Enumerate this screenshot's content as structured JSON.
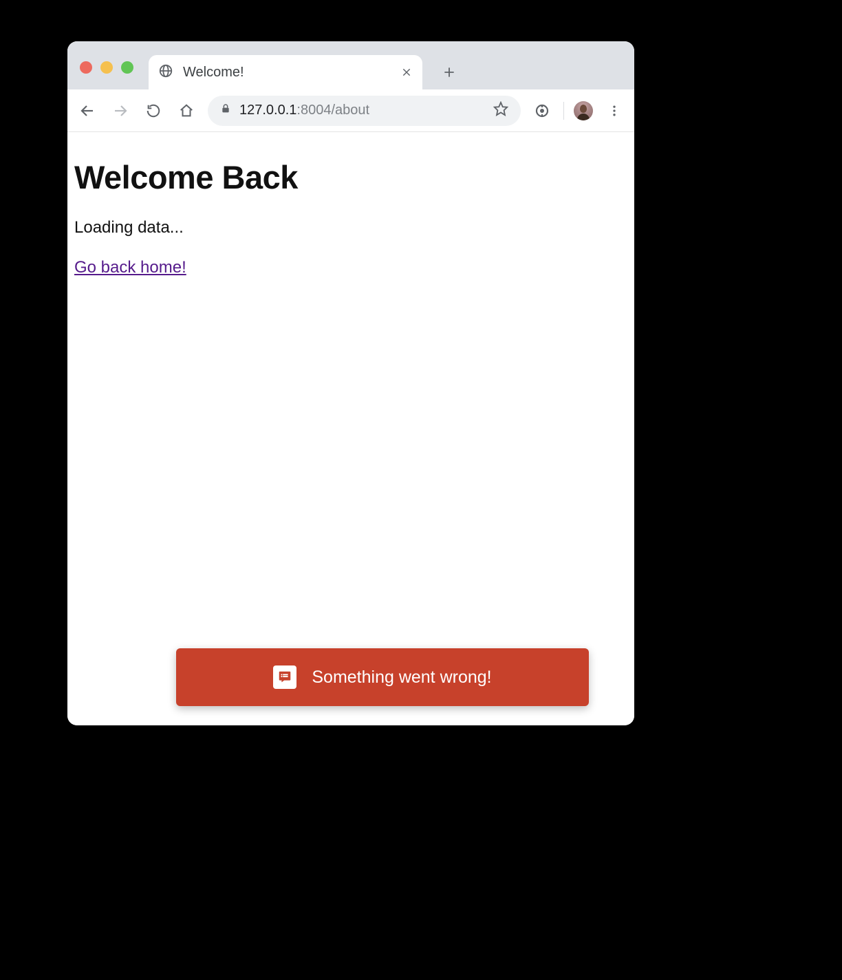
{
  "browser": {
    "tab_title": "Welcome!",
    "url_host": "127.0.0.1",
    "url_port_path": ":8004/about"
  },
  "page": {
    "heading": "Welcome Back",
    "loading_text": "Loading data...",
    "home_link_text": "Go back home!"
  },
  "snackbar": {
    "message": "Something went wrong!"
  }
}
